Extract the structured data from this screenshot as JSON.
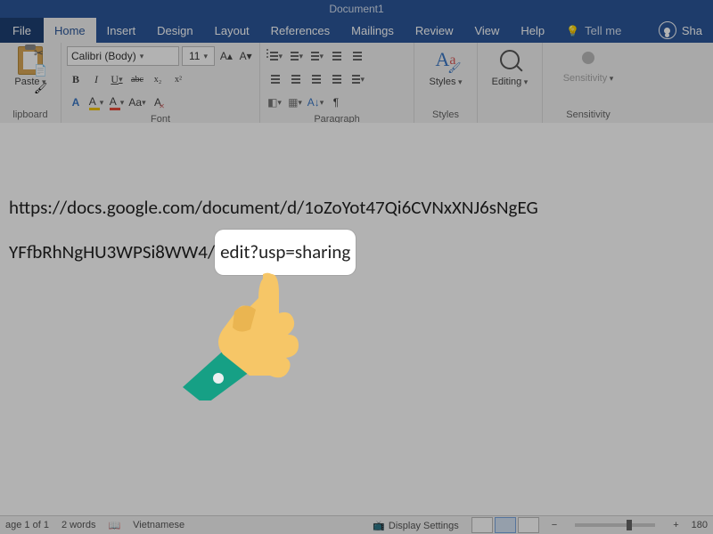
{
  "titlebar": {
    "doc_title": "Document1"
  },
  "tabs": {
    "file": "File",
    "home": "Home",
    "insert": "Insert",
    "design": "Design",
    "layout": "Layout",
    "references": "References",
    "mailings": "Mailings",
    "review": "Review",
    "view": "View",
    "help": "Help",
    "tellme": "Tell me",
    "share": "Sha"
  },
  "ribbon": {
    "clipboard": {
      "paste": "Paste",
      "label": "lipboard"
    },
    "font": {
      "name": "Calibri (Body)",
      "size": "11",
      "grow": "A▴",
      "shrink": "A▾",
      "clear": "A",
      "bold": "B",
      "italic": "I",
      "underline": "U",
      "strike": "abc",
      "sub": "x₂",
      "sup": "x²",
      "caseAa": "Aa",
      "label": "Font"
    },
    "paragraph": {
      "pilcrow": "¶",
      "label": "Paragraph"
    },
    "styles": {
      "btn": "Styles",
      "label": "Styles"
    },
    "editing": {
      "btn": "Editing"
    },
    "sensitivity": {
      "btn": "Sensitivity",
      "label": "Sensitivity"
    }
  },
  "document": {
    "url_part1": "https://docs.google.com/document/d/1oZoYot47Qi6CVNxXNJ6sNgEG",
    "url_part2": "YFfbRhNgHU3WPSi8WW4/",
    "url_highlight": "edit?usp=sharing"
  },
  "statusbar": {
    "page": "age 1 of 1",
    "words": "2 words",
    "language": "Vietnamese",
    "display": "Display Settings",
    "minus": "−",
    "plus": "+",
    "zoom": "180"
  }
}
